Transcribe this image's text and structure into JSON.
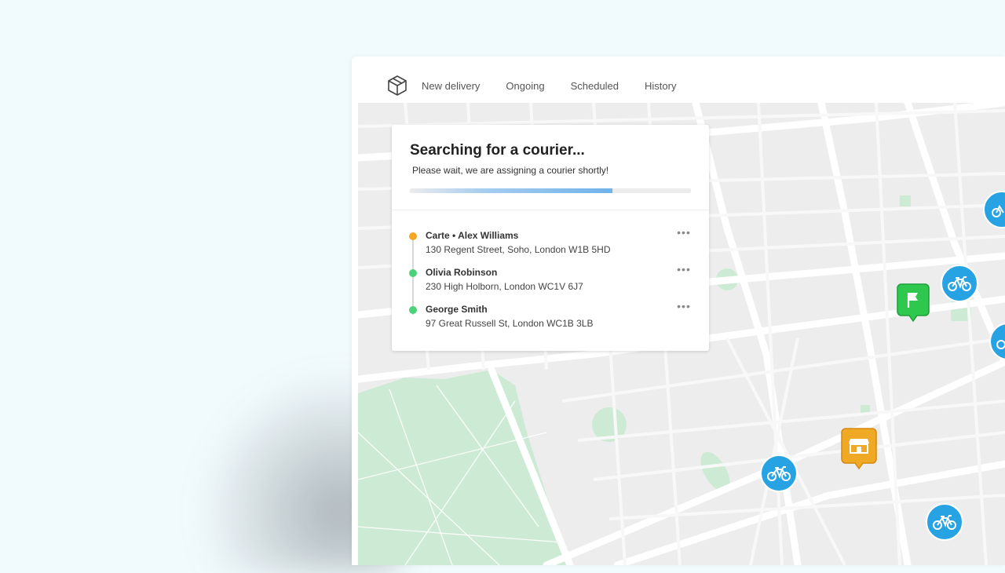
{
  "nav": {
    "links": [
      "New delivery",
      "Ongoing",
      "Scheduled",
      "History"
    ]
  },
  "status_card": {
    "title": "Searching for a courier...",
    "subtitle": "Please wait, we are assigning a courier shortly!",
    "progress": 0.72,
    "stops": [
      {
        "name": "Carte • Alex Williams",
        "address": "130 Regent Street, Soho, London W1B 5HD",
        "dot_color": "#f5a623"
      },
      {
        "name": "Olivia Robinson",
        "address": "230 High Holborn, London WC1V 6J7",
        "dot_color": "#4cd27a"
      },
      {
        "name": "George Smith",
        "address": "97 Great Russell St, London WC1B 3LB",
        "dot_color": "#4cd27a"
      }
    ],
    "more_label": "•••"
  },
  "map": {
    "markers": [
      "bike-icon",
      "bike-icon",
      "bike-icon",
      "bike-icon",
      "bike-icon",
      "flag-icon",
      "shop-icon"
    ],
    "colors": {
      "bike": "#27a2e2",
      "flag": "#2fc84f",
      "shop": "#f0a925",
      "park": "#cdebd4"
    }
  }
}
